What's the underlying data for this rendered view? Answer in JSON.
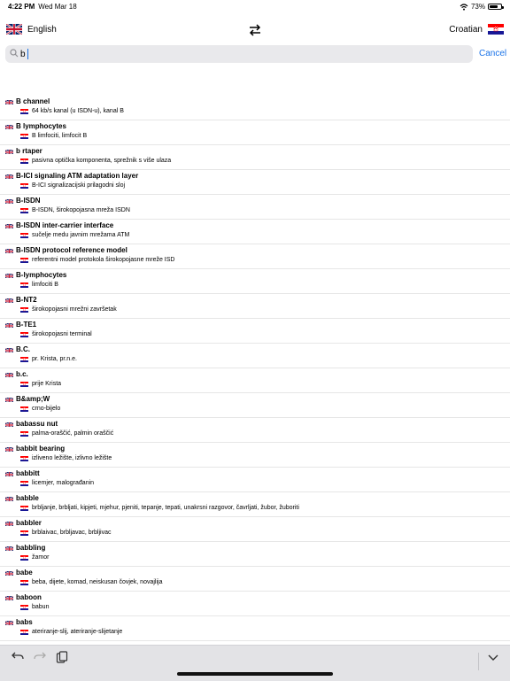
{
  "status_bar": {
    "time": "4:22 PM",
    "date": "Wed Mar 18",
    "battery": "73%",
    "battery_level": 0.73
  },
  "languages": {
    "source": "English",
    "target": "Croatian",
    "swap_icon": "swap-arrows-icon"
  },
  "search": {
    "value": "b",
    "placeholder": "",
    "cancel_label": "Cancel"
  },
  "entries": [
    {
      "term": "B channel",
      "translation": "64 kb/s kanal (u ISDN-u), kanal B"
    },
    {
      "term": "B lymphocytes",
      "translation": "B limfociti, limfocit B"
    },
    {
      "term": "b rtaper",
      "translation": "pasivna optička komponenta, sprežnik s više ulaza"
    },
    {
      "term": "B-ICI signaling ATM adaptation layer",
      "translation": "B-ICI signalizacijski prilagodni sloj"
    },
    {
      "term": "B-ISDN",
      "translation": "B-ISDN, širokopojasna mreža ISDN"
    },
    {
      "term": "B-ISDN inter-carrier interface",
      "translation": "sučelje medu javnim mrežama ATM"
    },
    {
      "term": "B-ISDN protocol reference model",
      "translation": "referentni model protokola širokopojasne mreže ISD"
    },
    {
      "term": "B-lymphocytes",
      "translation": "limfociti B"
    },
    {
      "term": "B-NT2",
      "translation": "širokopojasni mrežni završetak"
    },
    {
      "term": "B-TE1",
      "translation": "širokopojasni terminal"
    },
    {
      "term": "B.C.",
      "translation": "pr. Krista, pr.n.e."
    },
    {
      "term": "b.c.",
      "translation": "prije Krista"
    },
    {
      "term": "B&amp;W",
      "translation": "crno-bijelo"
    },
    {
      "term": "babassu nut",
      "translation": "palma-oraščić, palmin oraščić"
    },
    {
      "term": "babbit bearing",
      "translation": "izliveno ležište, izlivno ležište"
    },
    {
      "term": "babbitt",
      "translation": "licemjer, malograđanin"
    },
    {
      "term": "babble",
      "translation": "brbljanje, brbljati, kipjeti, mjehur, pjeniti, tepanje, tepati, unakrsni razgovor, čavrljati, žubor, žuboriti"
    },
    {
      "term": "babbler",
      "translation": "brblaivac, brbljavac, brbljivac"
    },
    {
      "term": "babbling",
      "translation": "žamor"
    },
    {
      "term": "babe",
      "translation": "beba, dijete, komad, neiskusan čovjek, novajlija"
    },
    {
      "term": "baboon",
      "translation": "babun"
    },
    {
      "term": "babs",
      "translation": "ateriranje-slij, ateriranje-slijetanje"
    }
  ],
  "toolbar": {
    "undo_icon": "undo-icon",
    "redo_icon": "redo-icon",
    "clipboard_icon": "clipboard-icon",
    "dismiss_icon": "chevron-down-icon"
  },
  "colors": {
    "accent": "#1a73e8",
    "search_bg": "#e9e9ec",
    "toolbar_bg": "#e3e3e6"
  }
}
